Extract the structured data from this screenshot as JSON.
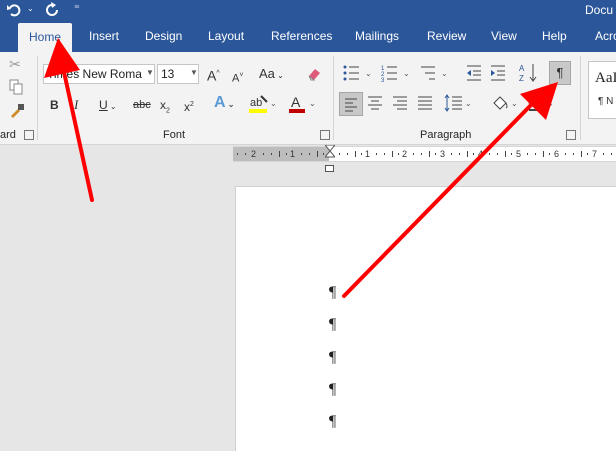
{
  "window": {
    "title": "Docu"
  },
  "tabs": [
    "Home",
    "Insert",
    "Design",
    "Layout",
    "References",
    "Mailings",
    "Review",
    "View",
    "Help",
    "Acro"
  ],
  "font": {
    "name": "Times New Roma",
    "size": "13",
    "change_case_label": "Aa"
  },
  "groups": {
    "clipboard": "ard",
    "font": "Font",
    "paragraph": "Paragraph"
  },
  "format_buttons": {
    "bold": "B",
    "italic": "I",
    "underline": "U",
    "strikethrough": "abc",
    "subscript": "x",
    "superscript": "x",
    "sub_mark": "2",
    "sup_mark": "2"
  },
  "styles": {
    "preview": "AaI",
    "label": "¶ N"
  },
  "show_marks_symbol": "¶",
  "document": {
    "paragraph_marks": [
      "¶",
      "¶",
      "¶",
      "¶",
      "¶"
    ]
  },
  "ruler": {
    "numbers": [
      "2",
      "1",
      "1",
      "2",
      "3",
      "4",
      "5",
      "6",
      "7"
    ]
  },
  "colors": {
    "word_blue": "#2b579a",
    "highlight": "#ffff00",
    "font_color": "#c00000",
    "annotation_arrow": "#ff0000"
  }
}
